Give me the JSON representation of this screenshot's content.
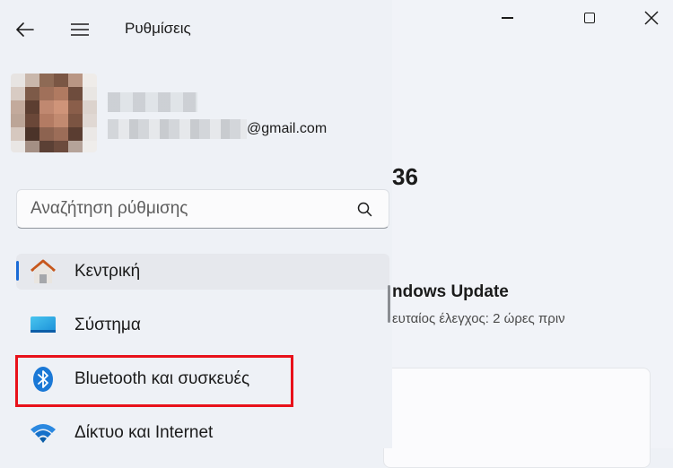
{
  "app": {
    "title": "Ρυθμίσεις"
  },
  "account": {
    "email_suffix": "@gmail.com"
  },
  "search": {
    "placeholder": "Αναζήτηση ρύθμισης"
  },
  "nav": {
    "items": [
      {
        "label": "Κεντρική",
        "icon": "home-icon",
        "selected": true
      },
      {
        "label": "Σύστημα",
        "icon": "system-display-icon"
      },
      {
        "label": "Bluetooth και συσκευές",
        "icon": "bluetooth-icon",
        "highlighted": true
      },
      {
        "label": "Δίκτυο και Internet",
        "icon": "wifi-icon"
      }
    ]
  },
  "main": {
    "version_fragment": "36",
    "update_title": "ndows Update",
    "update_subtitle": "ευταίος έλεγχος: 2 ώρες πριν"
  },
  "colors": {
    "accent": "#1a6bd6",
    "highlight_border": "#e8111a"
  }
}
